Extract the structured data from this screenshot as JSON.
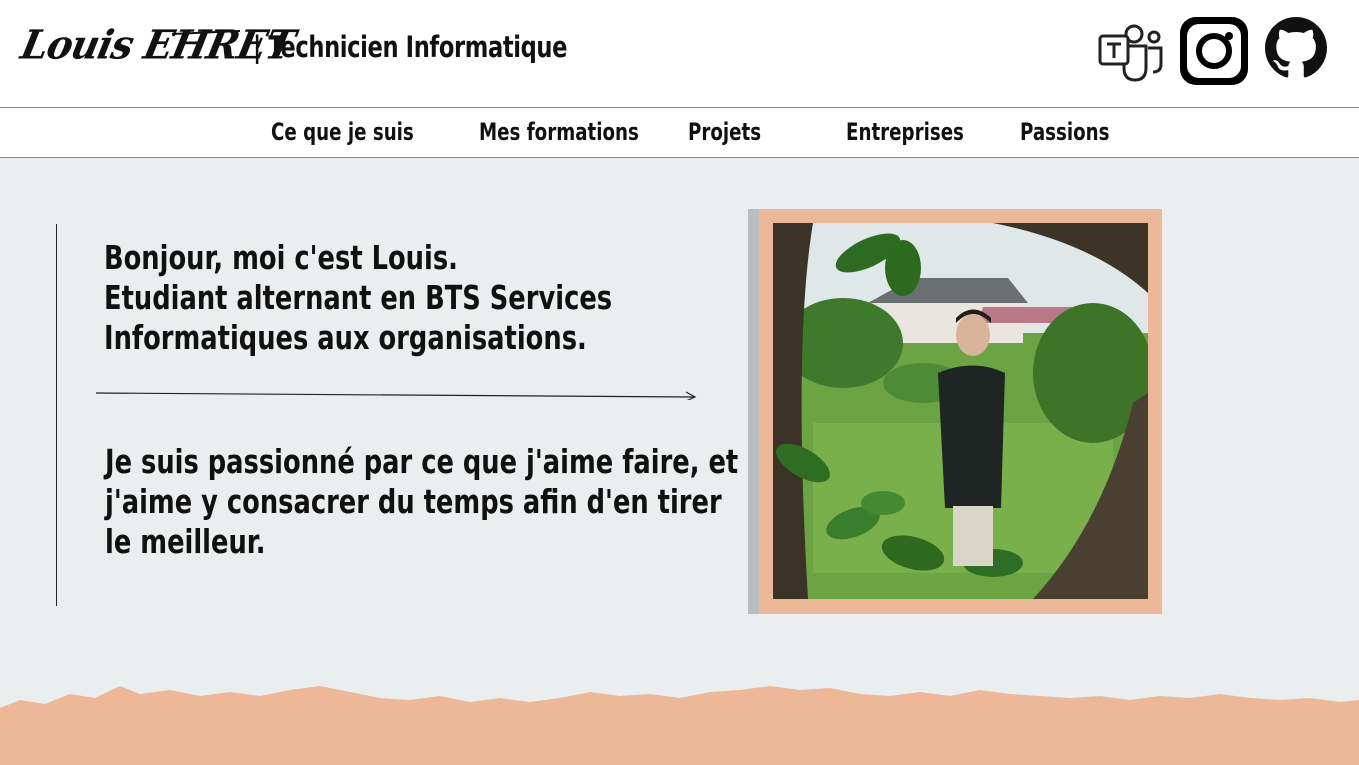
{
  "header": {
    "signature": "Louis EHRET",
    "tagline": "| Technicien Informatique",
    "social": [
      {
        "name": "teams",
        "icon": "microsoft-teams-icon"
      },
      {
        "name": "instagram",
        "icon": "instagram-icon"
      },
      {
        "name": "github",
        "icon": "github-icon"
      }
    ]
  },
  "nav": {
    "items": [
      {
        "label": "Ce que je suis"
      },
      {
        "label": "Mes formations"
      },
      {
        "label": "Projets"
      },
      {
        "label": "Entreprises"
      },
      {
        "label": "Passions"
      }
    ]
  },
  "main": {
    "intro": {
      "lines": [
        "Bonjour, moi c'est Louis.",
        "Etudiant alternant en BTS Services",
        "Informatiques aux organisations."
      ]
    },
    "passion": {
      "lines": [
        "Je suis passionné par ce que j'aime faire, et",
        "j'aime y consacrer du temps afin d'en tirer",
        "le meilleur."
      ]
    }
  },
  "colors": {
    "accent": "#edb898",
    "background": "#eaeeef",
    "frame_shadow": "#b8bdbd",
    "nav_border": "#a6844a",
    "text": "#111111"
  }
}
